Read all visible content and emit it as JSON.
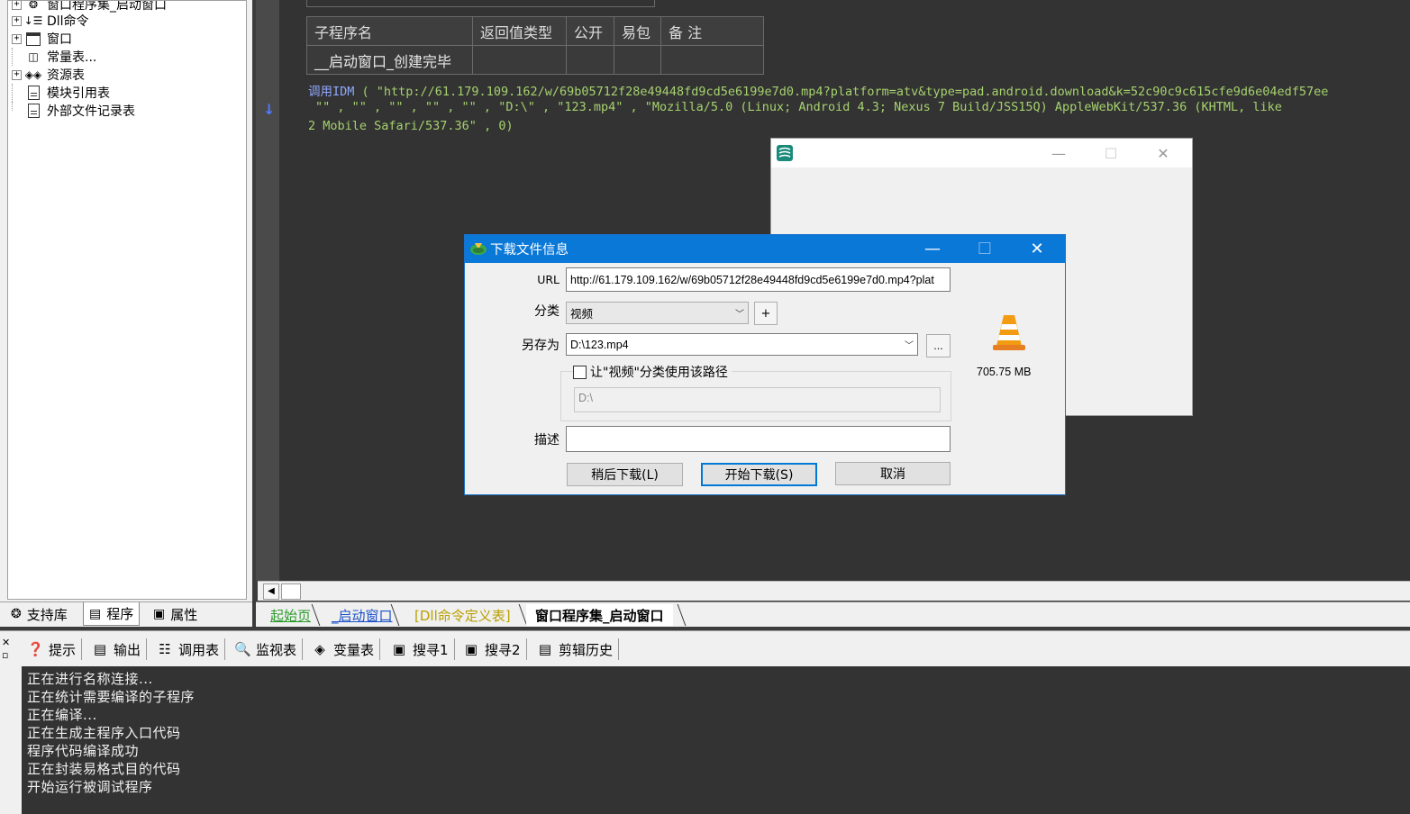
{
  "tree": {
    "items": [
      {
        "label": "窗口程序集_启动窗口",
        "expander": "+",
        "icon": "window-assembly-icon"
      },
      {
        "label": "Dll命令",
        "expander": "+",
        "icon": "dll-command-icon"
      },
      {
        "label": "窗口",
        "expander": "+",
        "icon": "window-icon"
      },
      {
        "label": "常量表...",
        "expander": "",
        "icon": "constant-table-icon"
      },
      {
        "label": "资源表",
        "expander": "+",
        "icon": "resource-table-icon"
      },
      {
        "label": "模块引用表",
        "expander": "",
        "icon": "module-reference-icon"
      },
      {
        "label": "外部文件记录表",
        "expander": "",
        "icon": "external-file-icon"
      }
    ]
  },
  "left_tabs": [
    {
      "label": "支持库",
      "icon": "library-icon"
    },
    {
      "label": "程序",
      "icon": "program-icon"
    },
    {
      "label": "属性",
      "icon": "properties-icon"
    }
  ],
  "proc_table": {
    "headers": [
      "子程序名",
      "返回值类型",
      "公开",
      "易包",
      "备 注"
    ],
    "row": [
      "__启动窗口_创建完毕",
      "",
      "",
      "",
      ""
    ]
  },
  "code": {
    "line1_kw": "调用IDM",
    "line1_rest": " ( \"http://61.179.109.162/w/69b05712f28e49448fd9cd5e6199e7d0.mp4?platform=atv&type=pad.android.download&k=52c90c9c615cfe9d6e04edf57ee",
    "line2": "\"\" , \"\" , \"\" , \"\" , \"\" , \"D:\\\" , \"123.mp4\" , \"Mozilla/5.0 (Linux; Android 4.3; Nexus 7 Build/JSS15Q) AppleWebKit/537.36 (KHTML, like",
    "line3": "2 Mobile Safari/537.36\" , 0)"
  },
  "page_tabs": [
    "起始页",
    "_启动窗口",
    "[Dll命令定义表]",
    "窗口程序集_启动窗口"
  ],
  "bottom_toolbar": [
    {
      "label": "提示",
      "icon": "hint-icon"
    },
    {
      "label": "输出",
      "icon": "output-icon"
    },
    {
      "label": "调用表",
      "icon": "call-table-icon"
    },
    {
      "label": "监视表",
      "icon": "watch-icon"
    },
    {
      "label": "变量表",
      "icon": "variable-icon"
    },
    {
      "label": "搜寻1",
      "icon": "search1-icon"
    },
    {
      "label": "搜寻2",
      "icon": "search2-icon"
    },
    {
      "label": "剪辑历史",
      "icon": "clipboard-history-icon"
    }
  ],
  "output_lines": [
    "正在进行名称连接...",
    "正在统计需要编译的子程序",
    "正在编译...",
    "正在生成主程序入口代码",
    "程序代码编译成功",
    "正在封装易格式目的代码",
    "开始运行被调试程序"
  ],
  "idm_dialog": {
    "title": "下载文件信息",
    "url_label": "URL",
    "url_value": "http://61.179.109.162/w/69b05712f28e49448fd9cd5e6199e7d0.mp4?plat",
    "category_label": "分类",
    "category_value": "视频",
    "add_category": "+",
    "saveas_label": "另存为",
    "saveas_value": "D:\\123.mp4",
    "browse": "...",
    "remember_checkbox": "让\"视频\"分类使用该路径",
    "remember_path": "D:\\",
    "description_label": "描述",
    "description_value": "",
    "file_size": "705.75  MB",
    "btn_later": "稍后下载(L)",
    "btn_start": "开始下载(S)",
    "btn_cancel": "取消"
  },
  "colors": {
    "code_bg": "#333333",
    "idm_titlebar": "#0a78d7",
    "string": "#a6d26e",
    "keyword": "#8fa8ff"
  }
}
